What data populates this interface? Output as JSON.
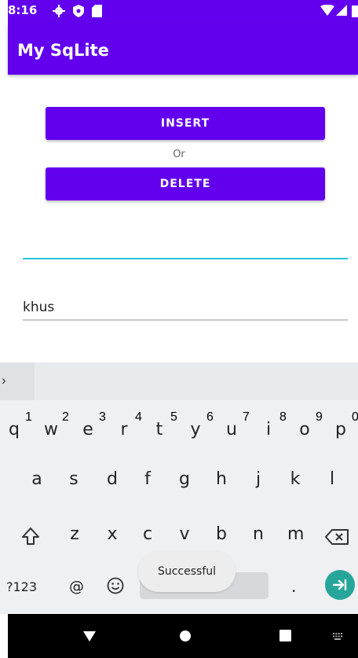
{
  "status_bar": {
    "time": "8:16"
  },
  "app_bar": {
    "title": "My SqLite"
  },
  "buttons": {
    "insert": "INSERT",
    "or": "Or",
    "delete": "DELETE"
  },
  "fields": {
    "first_value": "",
    "second_value": "khus"
  },
  "keyboard": {
    "row1": [
      {
        "key": "q",
        "hint": "1"
      },
      {
        "key": "w",
        "hint": "2"
      },
      {
        "key": "e",
        "hint": "3"
      },
      {
        "key": "r",
        "hint": "4"
      },
      {
        "key": "t",
        "hint": "5"
      },
      {
        "key": "y",
        "hint": "6"
      },
      {
        "key": "u",
        "hint": "7"
      },
      {
        "key": "i",
        "hint": "8"
      },
      {
        "key": "o",
        "hint": "9"
      },
      {
        "key": "p",
        "hint": "0"
      }
    ],
    "row2": [
      "a",
      "s",
      "d",
      "f",
      "g",
      "h",
      "j",
      "k",
      "l"
    ],
    "row3": [
      "z",
      "x",
      "c",
      "v",
      "b",
      "n",
      "m"
    ],
    "symbols_key": "?123",
    "at_key": "@",
    "period_key": "."
  },
  "toast": "Successful",
  "colors": {
    "primary": "#6200ee",
    "accent": "#26a69a",
    "focused_line": "#26c6da"
  }
}
